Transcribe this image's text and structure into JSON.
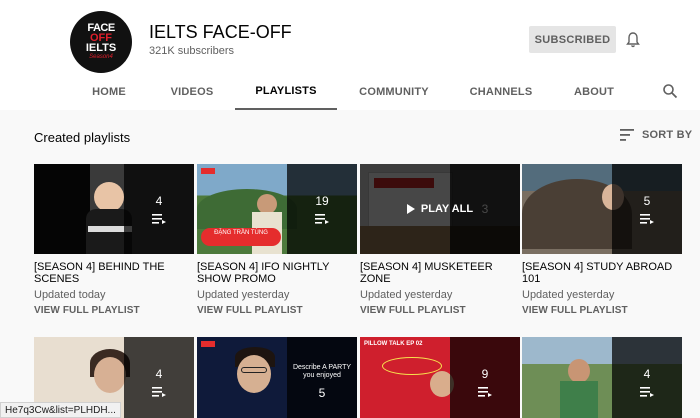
{
  "channel": {
    "name": "IELTS FACE-OFF",
    "subscribers": "321K subscribers",
    "subscribe_label": "SUBSCRIBED",
    "avatar_text": [
      "FACE",
      "OFF",
      "IELTS",
      "Season4"
    ]
  },
  "tabs": [
    {
      "label": "HOME",
      "active": false
    },
    {
      "label": "VIDEOS",
      "active": false
    },
    {
      "label": "PLAYLISTS",
      "active": true
    },
    {
      "label": "COMMUNITY",
      "active": false
    },
    {
      "label": "CHANNELS",
      "active": false
    },
    {
      "label": "ABOUT",
      "active": false
    }
  ],
  "icons": {
    "bell": "bell-icon",
    "search": "search-icon",
    "sort": "sort-icon",
    "playlist": "playlist-icon",
    "play": "play-icon"
  },
  "section": {
    "title": "Created playlists",
    "sort_label": "SORT BY"
  },
  "playlists": [
    {
      "title": "[SEASON 4] BEHIND THE SCENES",
      "count": "4",
      "updated": "Updated today",
      "link": "VIEW FULL PLAYLIST"
    },
    {
      "title": "[SEASON 4] IFO NIGHTLY SHOW PROMO",
      "count": "19",
      "updated": "Updated yesterday",
      "link": "VIEW FULL PLAYLIST",
      "thumb_text": "ĐẶNG TRẦN TÙNG"
    },
    {
      "title": "[SEASON 4] MUSKETEER ZONE",
      "count": "3",
      "updated": "Updated yesterday",
      "link": "VIEW FULL PLAYLIST",
      "hover_label": "PLAY ALL"
    },
    {
      "title": "[SEASON 4] STUDY ABROAD 101",
      "count": "5",
      "updated": "Updated yesterday",
      "link": "VIEW FULL PLAYLIST"
    },
    {
      "count": "4"
    },
    {
      "count": "5",
      "thumb_text": "Describe A PARTY you enjoyed"
    },
    {
      "count": "9",
      "thumb_text": "PILLOW TALK EP 02"
    },
    {
      "count": "4"
    }
  ],
  "status_url": "He7q3Cw&list=PLHDH...",
  "colors": {
    "background": "#f9f9f9",
    "header": "#ffffff",
    "brand_red": "#e01e2b",
    "text_secondary": "#606060"
  }
}
